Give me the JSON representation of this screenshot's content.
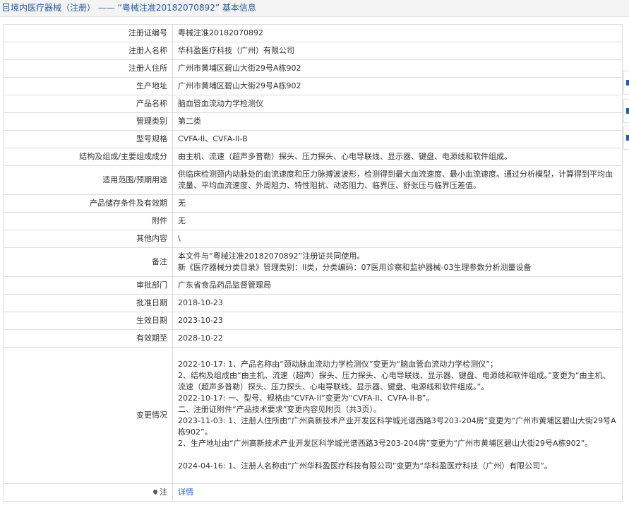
{
  "header": {
    "title": "境内医疗器械（注册） —— “粤械注准20182070892” 基本信息"
  },
  "rows": [
    {
      "label": "注册证编号",
      "value": "粤械注准20182070892"
    },
    {
      "label": "注册人名称",
      "value": "华科盈医疗科技（广州）有限公司"
    },
    {
      "label": "注册人住所",
      "value": "广州市黄埔区碧山大街29号A栋902"
    },
    {
      "label": "生产地址",
      "value": "广州市黄埔区碧山大街29号A栋902"
    },
    {
      "label": "产品名称",
      "value": "脑血管血流动力学检测仪"
    },
    {
      "label": "管理类别",
      "value": "第二类"
    },
    {
      "label": "型号规格",
      "value": "CVFA-II、CVFA-II-B"
    },
    {
      "label": "结构及组成/主要组成成分",
      "value": "由主机、流速（超声多普勒）探头、压力探头、心电导联线、显示器、键盘、电源线和软件组成。"
    },
    {
      "label": "适用范围/预期用途",
      "value": "供临床检测颈内动脉处的血流速度和压力脉搏波波形，检测得到最大血流速度、最小血流速度。通过分析模型，计算得到平均血流量、平均血流速度、外周阻力、特性阻抗、动态阻力、临界压、舒张压与临界压差值。"
    },
    {
      "label": "产品储存条件及有效期",
      "value": "无"
    },
    {
      "label": "附件",
      "value": "无"
    },
    {
      "label": "其他内容",
      "value": "\\"
    },
    {
      "label": "备注",
      "lines": [
        "本文件与“粤械注准20182070892”注册证共同使用。",
        "新《医疗器械分类目录》管理类别：II类，分类编码：07医用诊察和监护器械-03生理参数分析测量设备"
      ]
    },
    {
      "label": "审批部门",
      "value": "广东省食品药品监督管理局"
    },
    {
      "label": "批准日期",
      "value": "2018-10-23"
    },
    {
      "label": "生效日期",
      "value": "2023-10-23"
    },
    {
      "label": "有效期至",
      "value": "2028-10-22"
    },
    {
      "label": "变更情况",
      "lines": [
        "2022-10-17: 1、产品名称由“颈动脉血流动力学检测仪”变更为“脑血管血流动力学检测仪”；",
        "2、结构及组成由“由主机、流速（超声）探头、压力探头、心电导联线、显示器、键盘、电源线和软件组成。”变更为“由主机、流速（超声多普勒）探头、压力探头、心电导联线、显示器、键盘、电源线和软件组成。”。",
        "2022-10-17: 一、型号、规格由“CVFA-II”变更为“CVFA-II、CVFA-II-B”。",
        "二、注册证附件“产品技术要求”变更内容见附页（共3页）。",
        "2023-11-03: 1、注册人住所由“广州高新技术产业开发区科学城光谱西路3号203-204房”变更为“广州市黄埔区碧山大街29号A栋902”。",
        "2、生产地址由“广州高新技术产业开发区科学城光谱西路3号203-204房”变更为“广州市黄埔区碧山大街29号A栋902”。",
        "",
        "2024-04-16: 1、注册人名称由“广州华科盈医疗科技有限公司”变更为“华科盈医疗科技（广州）有限公司”。"
      ]
    },
    {
      "label": "注",
      "value": "详情"
    }
  ]
}
